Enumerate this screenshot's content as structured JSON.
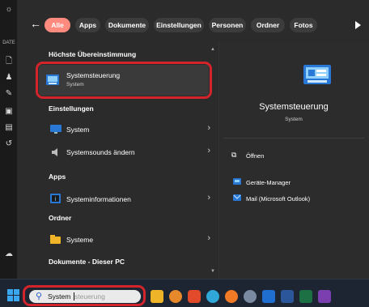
{
  "sidebar": {
    "label": "DATE"
  },
  "filters": {
    "chips": [
      "Alle",
      "Apps",
      "Dokumente",
      "Einstellungen",
      "Personen",
      "Ordner",
      "Fotos"
    ]
  },
  "results": {
    "best_match_header": "Höchste Übereinstimmung",
    "best_match": {
      "title": "Systemsteuerung",
      "subtitle": "System"
    },
    "settings_header": "Einstellungen",
    "settings": [
      "System",
      "Systemsounds ändern"
    ],
    "apps_header": "Apps",
    "apps": [
      "Systeminformationen"
    ],
    "folders_header": "Ordner",
    "folders": [
      "Systeme"
    ],
    "docs_header": "Dokumente - Dieser PC"
  },
  "preview": {
    "title": "Systemsteuerung",
    "subtitle": "System",
    "actions": [
      "Öffnen",
      "Geräte-Manager",
      "Mail (Microsoft Outlook)"
    ]
  },
  "taskbar": {
    "search_typed": "System",
    "search_ghost": "steuerung"
  },
  "colors": {
    "active_chip": "#ff8a7e",
    "highlight": "#d3242c",
    "accent": "#2a78d6"
  }
}
